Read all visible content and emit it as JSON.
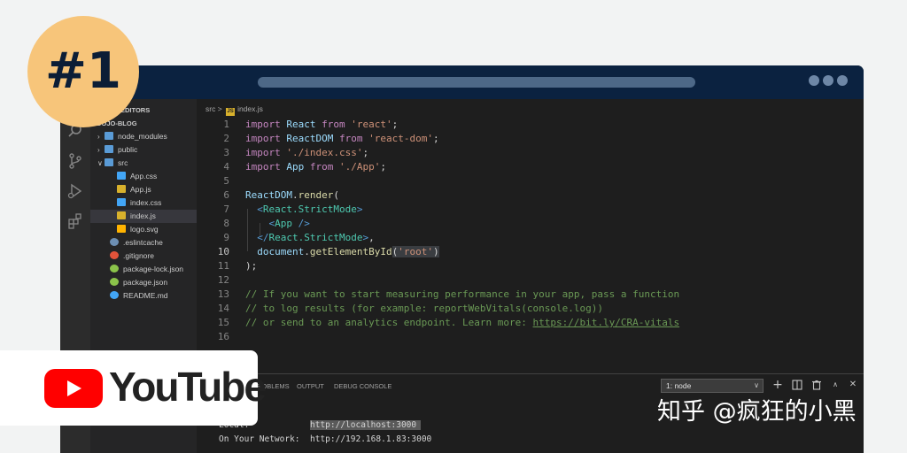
{
  "badge": {
    "text": "#1"
  },
  "youtube": {
    "text": "YouTube"
  },
  "watermark": {
    "text": "知乎 @疯狂的小黑"
  },
  "explorer": {
    "section_open_editors": "EDITORS",
    "project_name": "DOJO-BLOG",
    "items": [
      {
        "label": "node_modules",
        "type": "folder"
      },
      {
        "label": "public",
        "type": "folder"
      },
      {
        "label": "src",
        "type": "folder-open"
      },
      {
        "label": "App.css",
        "type": "css"
      },
      {
        "label": "App.js",
        "type": "js"
      },
      {
        "label": "index.css",
        "type": "css"
      },
      {
        "label": "index.js",
        "type": "js"
      },
      {
        "label": "logo.svg",
        "type": "svg"
      },
      {
        "label": ".eslintcache",
        "type": "cache"
      },
      {
        "label": ".gitignore",
        "type": "git"
      },
      {
        "label": "package-lock.json",
        "type": "json"
      },
      {
        "label": "package.json",
        "type": "json"
      },
      {
        "label": "README.md",
        "type": "info"
      }
    ]
  },
  "breadcrumb": {
    "folder": "src",
    "separator": ">",
    "badge": "JS",
    "file": "index.js"
  },
  "editor": {
    "current_line": 10,
    "lines": [
      [
        [
          "import ",
          "kw"
        ],
        [
          "React",
          "vr"
        ],
        [
          " from ",
          "kw"
        ],
        [
          "'react'",
          "st"
        ],
        [
          ";",
          "pu"
        ]
      ],
      [
        [
          "import ",
          "kw"
        ],
        [
          "ReactDOM",
          "vr"
        ],
        [
          " from ",
          "kw"
        ],
        [
          "'react-dom'",
          "st"
        ],
        [
          ";",
          "pu"
        ]
      ],
      [
        [
          "import ",
          "kw"
        ],
        [
          "'./index.css'",
          "st"
        ],
        [
          ";",
          "pu"
        ]
      ],
      [
        [
          "import ",
          "kw"
        ],
        [
          "App",
          "vr"
        ],
        [
          " from ",
          "kw"
        ],
        [
          "'./App'",
          "st"
        ],
        [
          ";",
          "pu"
        ]
      ],
      [],
      [
        [
          "ReactDOM",
          "vr"
        ],
        [
          ".",
          "pu"
        ],
        [
          "render",
          "fn"
        ],
        [
          "(",
          "pu"
        ]
      ],
      [
        [
          "  ",
          "pu"
        ],
        [
          "<",
          "tg"
        ],
        [
          "React.StrictMode",
          "cl"
        ],
        [
          ">",
          "tg"
        ]
      ],
      [
        [
          "    ",
          "pu"
        ],
        [
          "<",
          "tg"
        ],
        [
          "App",
          "cl"
        ],
        [
          " />",
          "tg"
        ]
      ],
      [
        [
          "  ",
          "pu"
        ],
        [
          "</",
          "tg"
        ],
        [
          "React.StrictMode",
          "cl"
        ],
        [
          ">",
          "tg"
        ],
        [
          ",",
          "pu"
        ]
      ],
      [
        [
          "  ",
          "pu"
        ],
        [
          "document",
          "vr"
        ],
        [
          ".",
          "pu"
        ],
        [
          "getElementById",
          "fn"
        ],
        [
          "(",
          "hl"
        ],
        [
          "'root'",
          "st hl"
        ],
        [
          ")",
          "hl"
        ]
      ],
      [
        [
          ");",
          "pu"
        ]
      ],
      [],
      [
        [
          "// If you want to start measuring performance in your app, pass a function",
          "cm"
        ]
      ],
      [
        [
          "// to log results (for example: reportWebVitals(console.log))",
          "cm"
        ]
      ],
      [
        [
          "// or send to an analytics endpoint. Learn more: ",
          "cm"
        ],
        [
          "https://bit.ly/CRA-vitals",
          "cm link"
        ]
      ],
      []
    ]
  },
  "panel": {
    "tabs": [
      "PROBLEMS",
      "OUTPUT",
      "DEBUG CONSOLE"
    ],
    "terminal_select": "1: node",
    "icons": [
      "plus-icon",
      "split-icon",
      "trash-icon",
      "chevron-up-icon",
      "close-icon"
    ],
    "terminal": [
      {
        "label": "Local:",
        "value": "http://localhost:3000"
      },
      {
        "label": "On Your Network:",
        "value": "http://192.168.1.83:3000"
      }
    ]
  },
  "colors": {
    "titlebar": "#0b2240",
    "badge": "#f7c57a",
    "youtube_red": "#ff0000"
  }
}
